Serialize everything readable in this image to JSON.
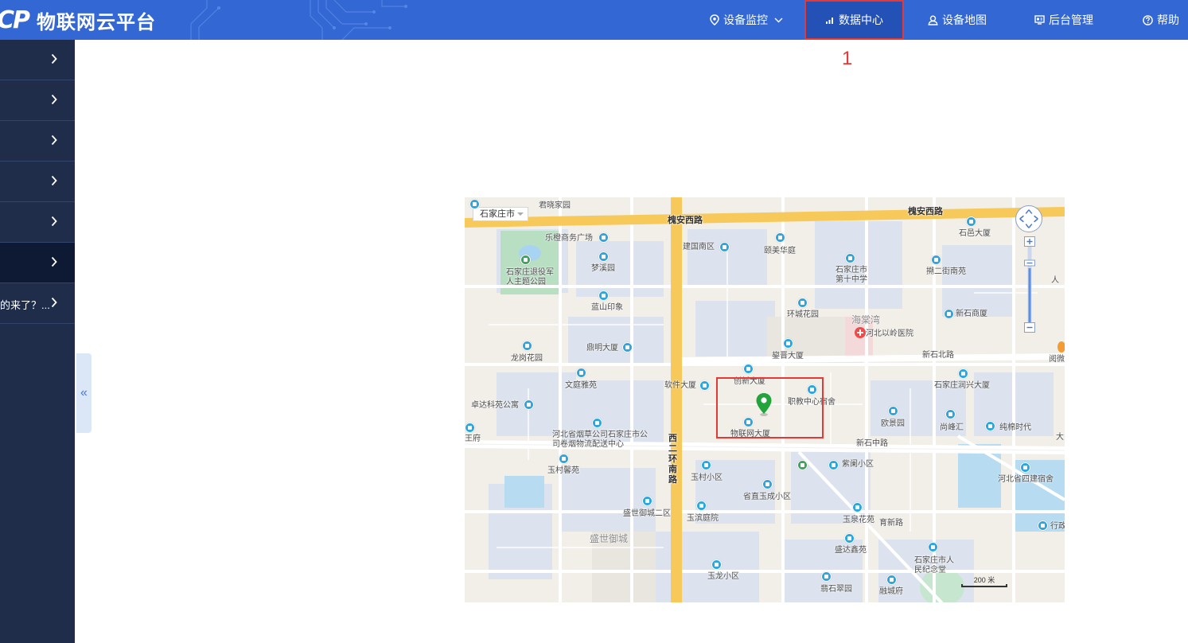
{
  "app": {
    "logo_mark": "CP",
    "title": "物联网云平台"
  },
  "nav": {
    "monitor": {
      "label": "设备监控",
      "icon": "location-pin-icon",
      "has_dropdown": true
    },
    "data_center": {
      "label": "数据中心",
      "icon": "bar-chart-icon",
      "active": true
    },
    "device_map": {
      "label": "设备地图",
      "icon": "user-icon"
    },
    "admin": {
      "label": "后台管理",
      "icon": "monitor-icon"
    },
    "help": {
      "label": "帮助",
      "icon": "question-circle-icon"
    }
  },
  "annotation": {
    "number": "1",
    "color": "#e53935"
  },
  "sidebar": {
    "items": [
      {
        "label": "",
        "active": false
      },
      {
        "label": "",
        "active": false
      },
      {
        "label": "",
        "active": false
      },
      {
        "label": "",
        "active": false
      },
      {
        "label": "",
        "active": false
      },
      {
        "label": "",
        "active": true
      },
      {
        "label": "的来了？...",
        "active": false
      }
    ],
    "collapse_label": "«"
  },
  "map": {
    "city": "石家庄市",
    "scale": "200 米",
    "labels": {
      "huaian_road_1": "槐安西路",
      "huaian_road_2": "槐安西路",
      "junxiao": "君晓家园",
      "lecheng": "乐橙商务广场",
      "theme_park": "石家庄退役军人主题公园",
      "mengxi": "梦溪园",
      "lanshan": "蓝山印象",
      "jianguo": "建国南区",
      "yimei": "颐美华庭",
      "school": "石家庄市第十中学",
      "shiyi": "石邑大厦",
      "zhuer": "搠二街南苑",
      "huancheng": "环城花园",
      "haitang": "海棠湾",
      "hospital": "河北以岭医院",
      "xinshi_bldg": "新石商厦",
      "dingming": "鼎明大厦",
      "yujin": "鋆晋大厦",
      "longgang": "龙岗花园",
      "xinshi_north": "新石北路",
      "wenting": "文庭雅苑",
      "software": "软件大厦",
      "chuangxin": "创新大厦",
      "zhijiao": "职教中心宿舍",
      "runxing": "石家庄润兴大厦",
      "zhuoda": "卓达科苑公寓",
      "oujing": "欧景园",
      "shangfeng": "尚峰汇",
      "chunmian": "纯棉时代",
      "tobacco": "河北省烟草公司石家庄市公司卷烟物流配送中心",
      "iot_bldg": "物联网大厦",
      "west_ring": "西二环南路",
      "xinshi_mid": "新石中路",
      "yucun_xiu": "玉村馨苑",
      "yucun": "玉村小区",
      "zilan": "紫阑小区",
      "sijian": "河北省四建宿舍",
      "shengzhi": "省直玉成小区",
      "shengshi2": "盛世御城二区",
      "yubin": "玉滨庭院",
      "yuquan": "玉泉花苑",
      "yuxin": "育新路",
      "shengshi": "盛世御城",
      "shengda": "盛达鑫苑",
      "memorial": "石家庄市人民纪念堂",
      "yulong": "玉龙小区",
      "feicui": "翡石翠园",
      "rongcheng": "融城府",
      "wangfu": "王府",
      "xingzheng": "行政",
      "yuewei": "阅微",
      "edge_da": "大",
      "edge_ren": "人"
    }
  },
  "colors": {
    "header_bg": "#3267d4",
    "nav_active_bg": "#2451b5",
    "sidebar_bg": "#1f2d4b",
    "highlight_red": "#e53935",
    "map_road_major": "#f7c95b",
    "poi_blue": "#2aa7e0"
  }
}
